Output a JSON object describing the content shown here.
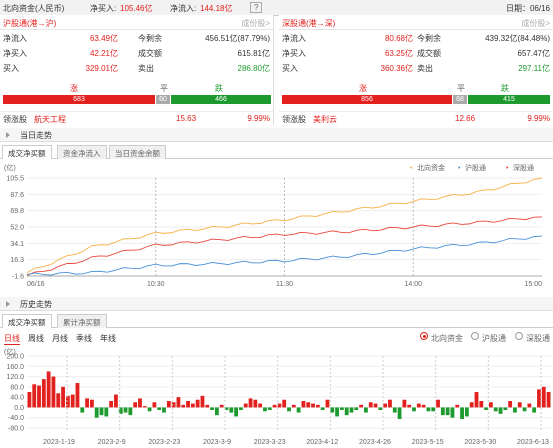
{
  "topbar": {
    "title": "北向资金(人民币)",
    "net_buy_label": "净买入:",
    "net_buy": "105.46亿",
    "net_in_label": "净流入:",
    "net_in": "144.18亿",
    "help": "?",
    "date": "日期：06/16"
  },
  "sh": {
    "title": "沪股通(港→沪)",
    "link": "成份股>",
    "rows": [
      [
        "净流入",
        "63.49亿",
        "今剩余",
        "456.51亿(87.79%)"
      ],
      [
        "净买入",
        "42.21亿",
        "成交额",
        "615.81亿"
      ],
      [
        "买入",
        "329.01亿",
        "卖出",
        "286.80亿"
      ]
    ],
    "up_label": "涨",
    "flat_label": "平",
    "down_label": "跌",
    "up": "683",
    "flat": "60",
    "down": "466",
    "leader_label": "领涨股",
    "leader": "航天工程",
    "leader_price": "15.63",
    "leader_pct": "9.99%"
  },
  "sz": {
    "title": "深股通(港→深)",
    "link": "成份股>",
    "rows": [
      [
        "净流入",
        "80.68亿",
        "今剩余",
        "439.32亿(84.48%)"
      ],
      [
        "净买入",
        "63.25亿",
        "成交额",
        "657.47亿"
      ],
      [
        "买入",
        "360.36亿",
        "卖出",
        "297.11亿"
      ]
    ],
    "up_label": "涨",
    "flat_label": "平",
    "down_label": "跌",
    "up": "856",
    "flat": "68",
    "down": "415",
    "leader_label": "领涨股",
    "leader": "美利云",
    "leader_price": "12.66",
    "leader_pct": "9.99%"
  },
  "intraday": {
    "section": "当日走势",
    "tabs": [
      "成交净买额",
      "资金净流入",
      "当日资金余额"
    ]
  },
  "history": {
    "section": "历史走势",
    "tabs": [
      "成交净买额",
      "累计净买额"
    ],
    "periods": [
      "日线",
      "周线",
      "月线",
      "季线",
      "年线"
    ],
    "legend": [
      "北向资金",
      "沪股通",
      "深股通"
    ]
  },
  "colors": {
    "north": "#f5b041",
    "sh": "#4a90d9",
    "sz": "#e8473d",
    "up": "#e2201d",
    "down": "#1d9a2d"
  },
  "chart_data": [
    {
      "type": "line",
      "unit": "(亿)",
      "x": [
        "09:30",
        "10:00",
        "10:30",
        "11:00",
        "11:30",
        "13:30",
        "14:00",
        "14:30",
        "15:00"
      ],
      "x_ticks": [
        "06/16",
        "10:30",
        "11:30",
        "14:00",
        "15:00"
      ],
      "y_ticks": [
        "105.5",
        "87.6",
        "69.8",
        "52.0",
        "34.1",
        "16.3",
        "-1.6"
      ],
      "ylim": [
        -1.6,
        105.5
      ],
      "legend": [
        "北向资金",
        "沪股通",
        "深股通"
      ],
      "series": [
        {
          "name": "北向资金",
          "values": [
            2,
            30,
            45,
            52,
            60,
            70,
            80,
            90,
            105.5
          ]
        },
        {
          "name": "深股通",
          "values": [
            -1,
            18,
            32,
            38,
            44,
            47,
            52,
            57,
            63
          ]
        },
        {
          "name": "沪股通",
          "values": [
            0,
            2,
            10,
            12,
            15,
            20,
            28,
            34,
            42
          ]
        }
      ]
    },
    {
      "type": "bar",
      "unit": "(亿)",
      "y_ticks": [
        "200.0",
        "160.0",
        "120.0",
        "80.0",
        "40.0",
        "0.0",
        "-40.0",
        "-80.0"
      ],
      "ylim": [
        -80,
        200
      ],
      "x_ticks": [
        "2023-1-19",
        "2023-2-9",
        "2023-2-23",
        "2023-3-9",
        "2023-3-23",
        "2023-4-12",
        "2023-4-26",
        "2023-5-15",
        "2023-5-30",
        "2023-6-13"
      ],
      "values": [
        60,
        90,
        85,
        110,
        140,
        120,
        55,
        80,
        45,
        50,
        95,
        -20,
        35,
        30,
        -40,
        -30,
        -35,
        25,
        50,
        -25,
        -20,
        -30,
        20,
        35,
        5,
        -15,
        20,
        -10,
        -20,
        25,
        20,
        40,
        10,
        25,
        15,
        30,
        45,
        10,
        -10,
        -30,
        10,
        -10,
        -20,
        -35,
        -10,
        15,
        35,
        30,
        15,
        -15,
        -10,
        10,
        15,
        30,
        -15,
        10,
        -20,
        25,
        20,
        15,
        10,
        -10,
        30,
        -20,
        -35,
        -10,
        -30,
        -20,
        -10,
        10,
        -20,
        20,
        15,
        -10,
        15,
        30,
        -20,
        -45,
        30,
        10,
        -15,
        15,
        10,
        -15,
        -15,
        30,
        -30,
        -30,
        -40,
        10,
        -45,
        -35,
        20,
        60,
        25,
        -10,
        20,
        -15,
        -25,
        -10,
        25,
        -20,
        20,
        -15,
        15,
        -20,
        70,
        80,
        60
      ]
    }
  ]
}
